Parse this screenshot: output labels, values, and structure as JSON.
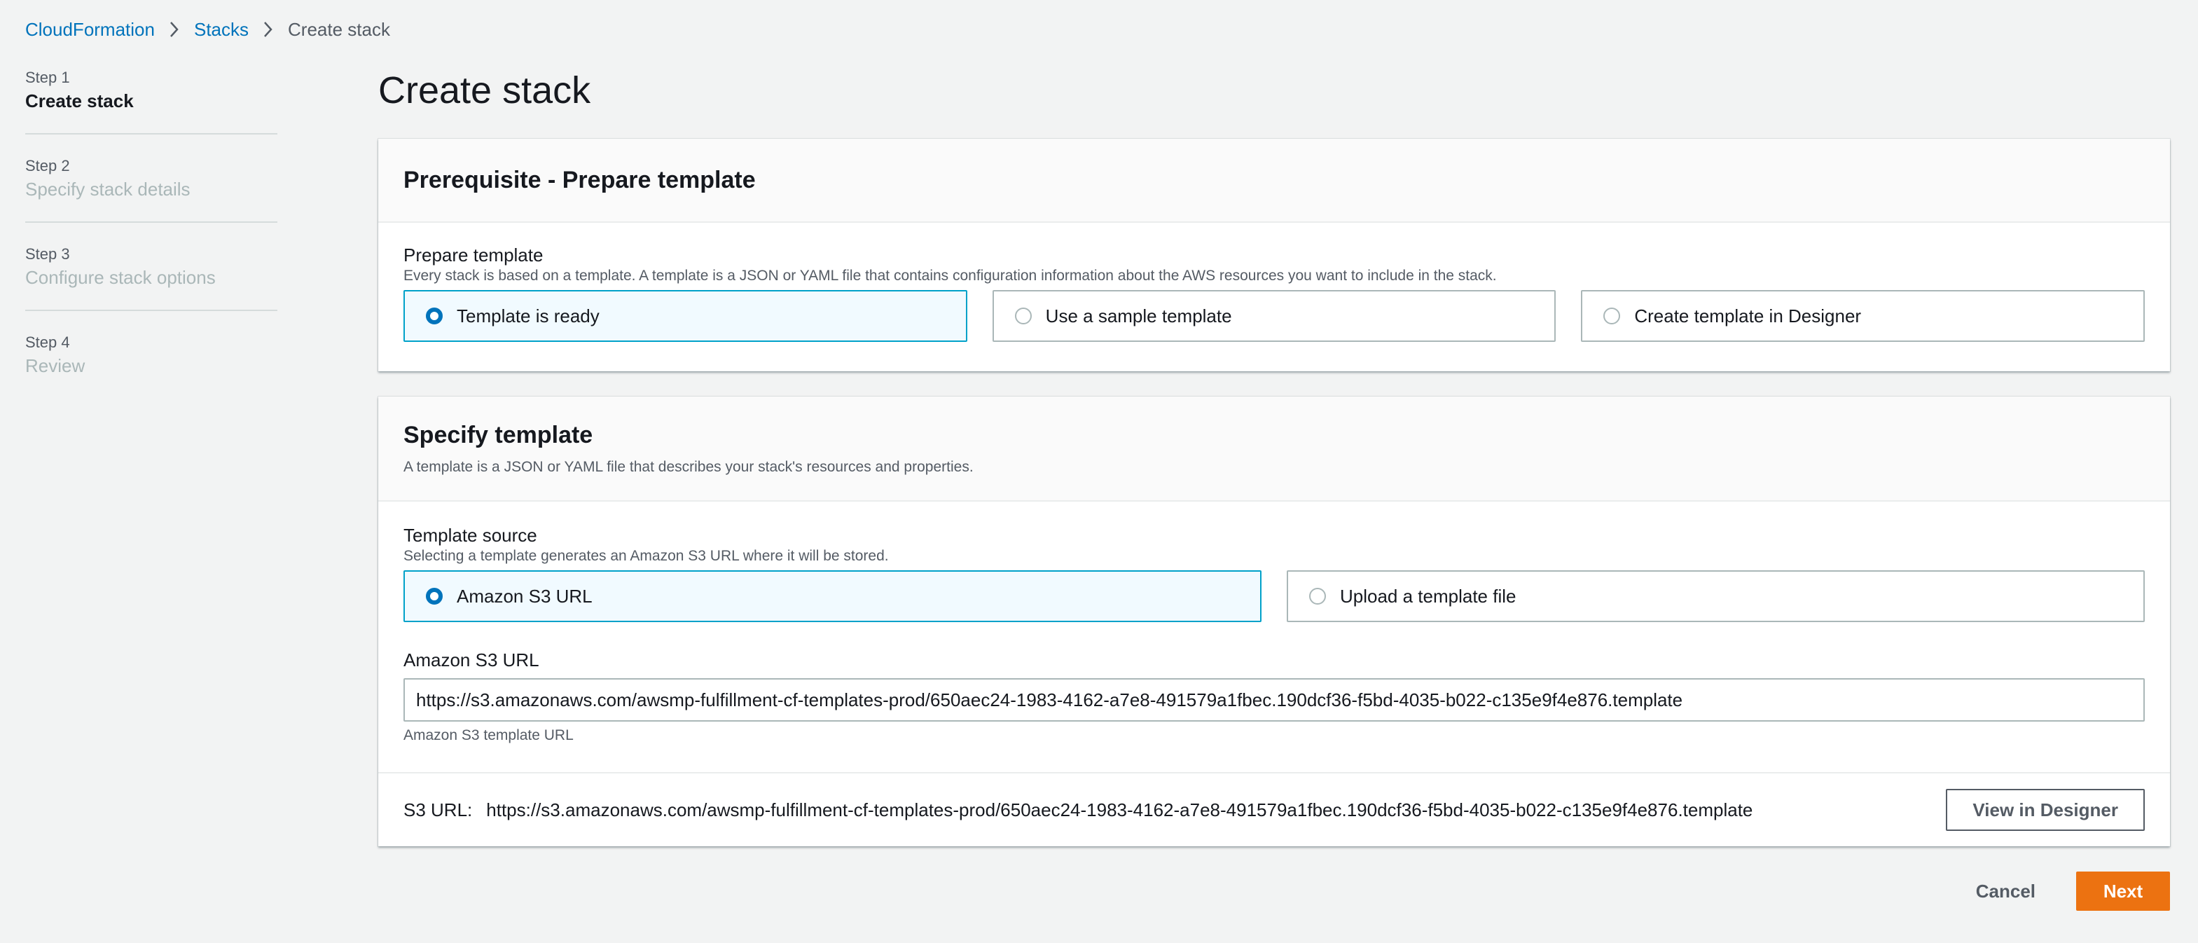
{
  "breadcrumb": {
    "items": [
      "CloudFormation",
      "Stacks"
    ],
    "current": "Create stack"
  },
  "steps": [
    {
      "num": "Step 1",
      "label": "Create stack"
    },
    {
      "num": "Step 2",
      "label": "Specify stack details"
    },
    {
      "num": "Step 3",
      "label": "Configure stack options"
    },
    {
      "num": "Step 4",
      "label": "Review"
    }
  ],
  "page_title": "Create stack",
  "prerequisite": {
    "title": "Prerequisite - Prepare template",
    "field_label": "Prepare template",
    "field_desc": "Every stack is based on a template. A template is a JSON or YAML file that contains configuration information about the AWS resources you want to include in the stack.",
    "options": [
      "Template is ready",
      "Use a sample template",
      "Create template in Designer"
    ],
    "selected_index": 0
  },
  "specify": {
    "title": "Specify template",
    "desc": "A template is a JSON or YAML file that describes your stack's resources and properties.",
    "source_label": "Template source",
    "source_desc": "Selecting a template generates an Amazon S3 URL where it will be stored.",
    "options": [
      "Amazon S3 URL",
      "Upload a template file"
    ],
    "selected_index": 0,
    "url_label": "Amazon S3 URL",
    "url_value": "https://s3.amazonaws.com/awsmp-fulfillment-cf-templates-prod/650aec24-1983-4162-a7e8-491579a1fbec.190dcf36-f5bd-4035-b022-c135e9f4e876.template",
    "url_hint": "Amazon S3 template URL",
    "s3_url_prefix": "S3 URL:",
    "s3_url": "https://s3.amazonaws.com/awsmp-fulfillment-cf-templates-prod/650aec24-1983-4162-a7e8-491579a1fbec.190dcf36-f5bd-4035-b022-c135e9f4e876.template",
    "view_designer_label": "View in Designer"
  },
  "actions": {
    "cancel_label": "Cancel",
    "next_label": "Next"
  },
  "colors": {
    "accent": "#0073bb",
    "primary": "#ec7211",
    "selected_border": "#00a1c9",
    "selected_bg": "#f1faff"
  }
}
